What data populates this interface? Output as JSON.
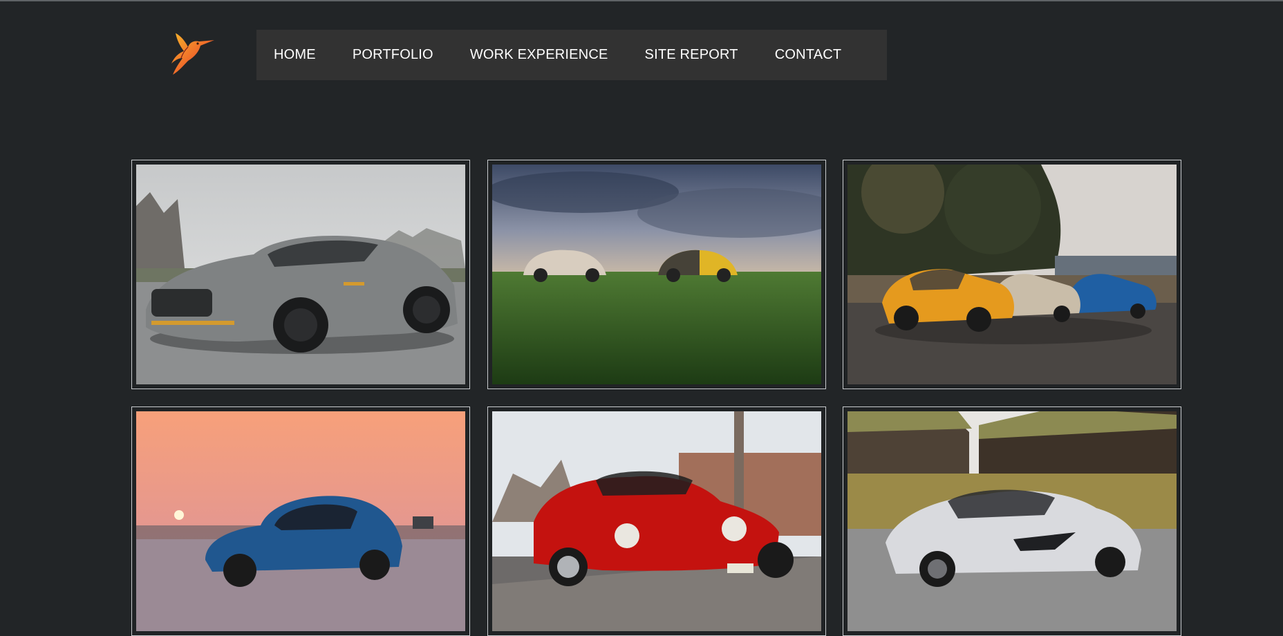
{
  "nav": {
    "items": [
      {
        "label": "HOME"
      },
      {
        "label": "PORTFOLIO"
      },
      {
        "label": "WORK EXPERIENCE"
      },
      {
        "label": "SITE REPORT"
      },
      {
        "label": "CONTACT"
      }
    ]
  },
  "logo": {
    "icon": "hummingbird-icon"
  },
  "gallery": {
    "photos": [
      {
        "subject": "silver-sports-car-photo"
      },
      {
        "subject": "two-beetles-in-field-photo"
      },
      {
        "subject": "three-classic-coupes-photo"
      },
      {
        "subject": "blue-coupe-at-sunset-photo"
      },
      {
        "subject": "red-classic-sports-car-photo"
      },
      {
        "subject": "white-supercar-photo"
      }
    ]
  }
}
